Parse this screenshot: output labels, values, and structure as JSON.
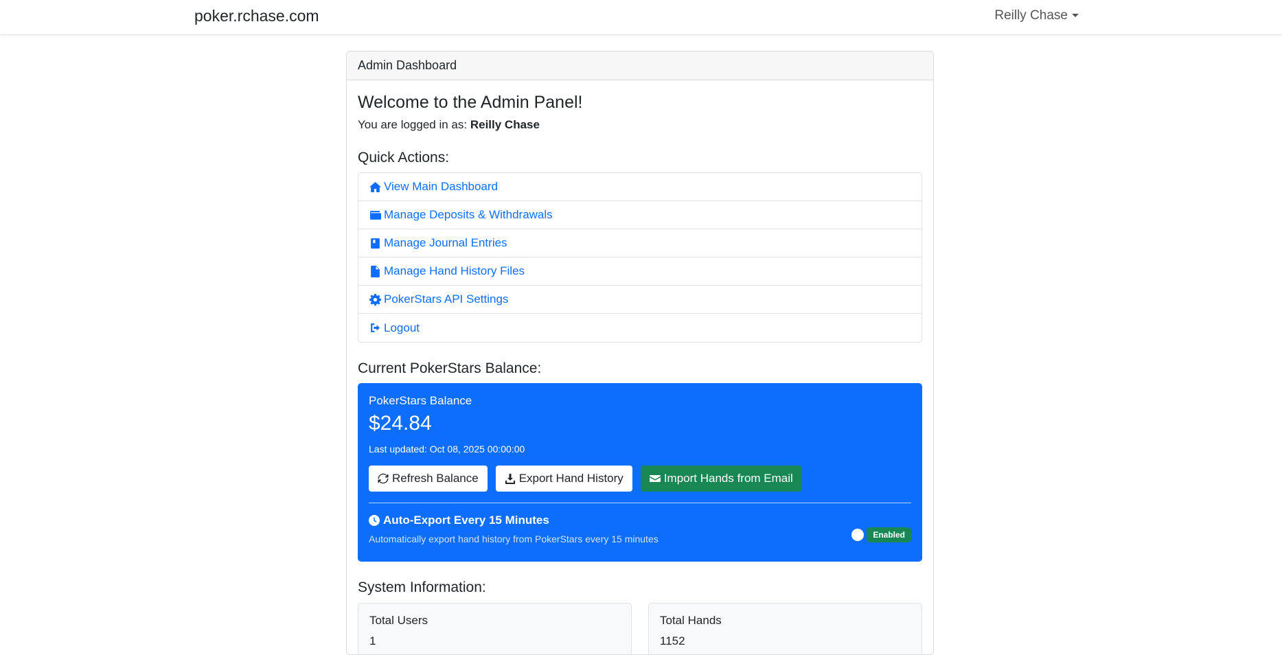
{
  "navbar": {
    "brand": "poker.rchase.com",
    "user_name": "Reilly Chase"
  },
  "card": {
    "header": "Admin Dashboard",
    "welcome": "Welcome to the Admin Panel!",
    "logged_in_prefix": "You are logged in as:",
    "logged_in_user": "Reilly Chase"
  },
  "quick_actions": {
    "title": "Quick Actions:",
    "items": [
      {
        "label": "View Main Dashboard",
        "icon": "home-icon"
      },
      {
        "label": "Manage Deposits & Withdrawals",
        "icon": "wallet-icon"
      },
      {
        "label": "Manage Journal Entries",
        "icon": "journal-icon"
      },
      {
        "label": "Manage Hand History Files",
        "icon": "file-icon"
      },
      {
        "label": "PokerStars API Settings",
        "icon": "gear-icon"
      },
      {
        "label": "Logout",
        "icon": "logout-icon"
      }
    ]
  },
  "balance": {
    "title": "Current PokerStars Balance:",
    "card_label": "PokerStars Balance",
    "amount": "$24.84",
    "last_updated": "Last updated: Oct 08, 2025 00:00:00",
    "buttons": {
      "refresh": "Refresh Balance",
      "export": "Export Hand History",
      "import": "Import Hands from Email"
    },
    "auto_export": {
      "title": "Auto-Export Every 15 Minutes",
      "description": "Automatically export hand history from PokerStars every 15 minutes",
      "status": "Enabled",
      "enabled": true
    }
  },
  "system": {
    "title": "System Information:",
    "stats": [
      {
        "label": "Total Users",
        "value": "1"
      },
      {
        "label": "Total Hands",
        "value": "1152"
      }
    ]
  },
  "colors": {
    "primary": "#0d6efd",
    "success": "#198754",
    "text": "#212529"
  }
}
